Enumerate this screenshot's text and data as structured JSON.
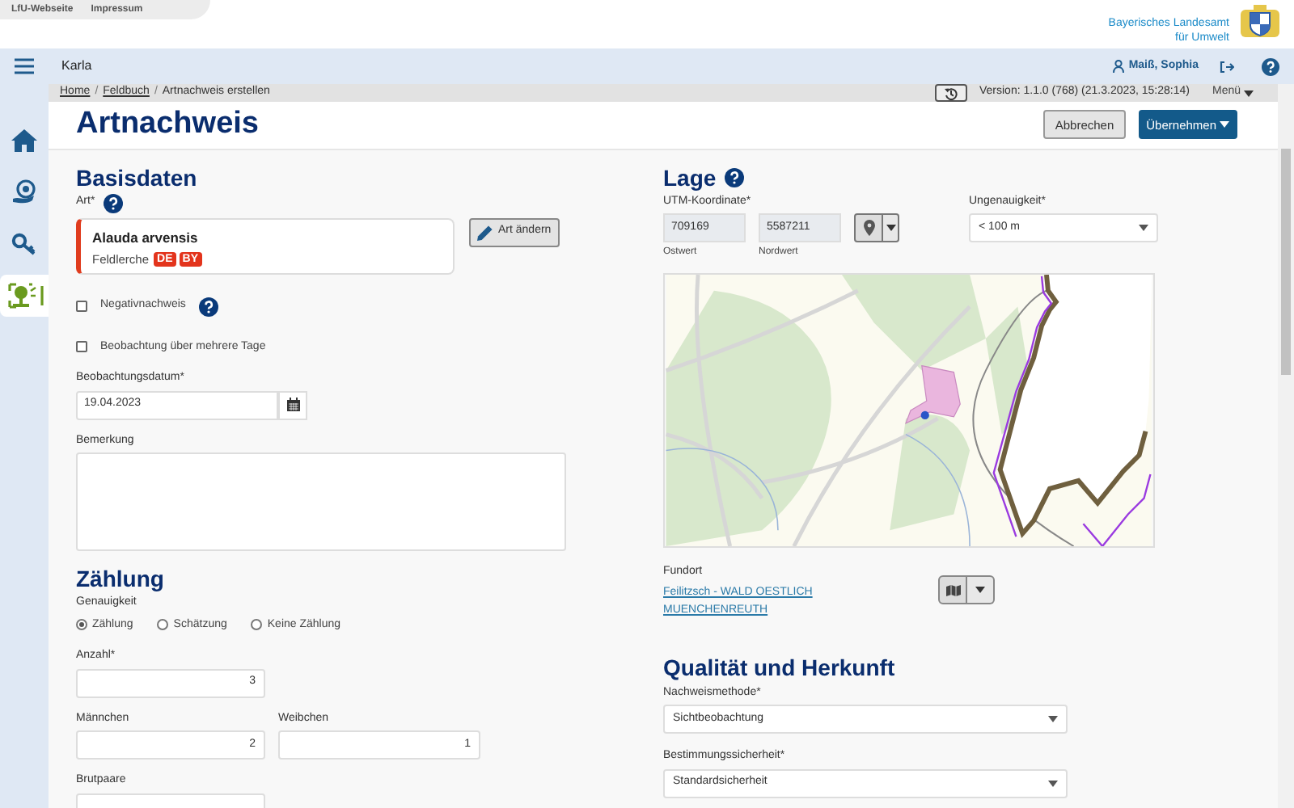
{
  "header": {
    "links": [
      "LfU-Webseite",
      "Impressum"
    ],
    "agency": "Bayerisches Landesamt für Umwelt"
  },
  "topbar": {
    "app_name": "Karla",
    "user": "Maiß, Sophia"
  },
  "breadcrumb": {
    "items": [
      {
        "label": "Home",
        "kind": "link"
      },
      {
        "label": "Feldbuch",
        "kind": "link"
      },
      {
        "label": "Artnachweis erstellen",
        "kind": "current"
      }
    ],
    "separator": "/",
    "version": "Version: 1.1.0 (768) (21.3.2023, 15:28:14)",
    "menu": "Menü"
  },
  "sidebar": {
    "items": [
      {
        "kind": "home",
        "selected": false
      },
      {
        "kind": "globe",
        "selected": false
      },
      {
        "kind": "search",
        "selected": false
      },
      {
        "kind": "tree",
        "selected": true
      }
    ]
  },
  "page": {
    "title": "Artnachweis",
    "buttons": [
      {
        "label": "Abbrechen",
        "kind": "secondary"
      },
      {
        "label": "Übernehmen",
        "kind": "primary"
      }
    ]
  },
  "basisdaten": {
    "heading": "Basisdaten",
    "art_label": "Art*",
    "species": {
      "scientific": "Alauda arvensis",
      "common": "Feldlerche",
      "badges": [
        "DE",
        "BY"
      ]
    },
    "change_button": "Art ändern",
    "checkboxes": [
      {
        "label": "Negativnachweis",
        "checked": false,
        "help": true
      },
      {
        "label": "Beobachtung über mehrere Tage",
        "checked": false,
        "help": false
      }
    ],
    "date_label": "Beobachtungsdatum*",
    "date_value": "19.04.2023",
    "remark_label": "Bemerkung"
  },
  "zaehlung": {
    "heading": "Zählung",
    "accuracy_label": "Genauigkeit",
    "radios": [
      {
        "label": "Zählung",
        "selected": true
      },
      {
        "label": "Schätzung",
        "selected": false
      },
      {
        "label": "Keine Zählung",
        "selected": false
      }
    ],
    "anzahl": {
      "label": "Anzahl*",
      "value": "3"
    },
    "maennchen": {
      "label": "Männchen",
      "value": "2"
    },
    "weibchen": {
      "label": "Weibchen",
      "value": "1"
    },
    "brutpaare": {
      "label": "Brutpaare"
    }
  },
  "lage": {
    "heading": "Lage",
    "utm_label": "UTM-Koordinate*",
    "east_value": "709169",
    "east_caption": "Ostwert",
    "north_value": "5587211",
    "north_caption": "Nordwert",
    "accuracy_label": "Ungenauigkeit*",
    "accuracy_value": "< 100 m",
    "fundort_label": "Fundort",
    "fundort_link": "Feilitzsch - WALD OESTLICH MUENCHENREUTH"
  },
  "qualitaet": {
    "heading": "Qualität und Herkunft",
    "selects": [
      {
        "label": "Nachweismethode*",
        "value": "Sichtbeobachtung"
      },
      {
        "label": "Bestimmungssicherheit*",
        "value": "Standardsicherheit"
      }
    ]
  }
}
